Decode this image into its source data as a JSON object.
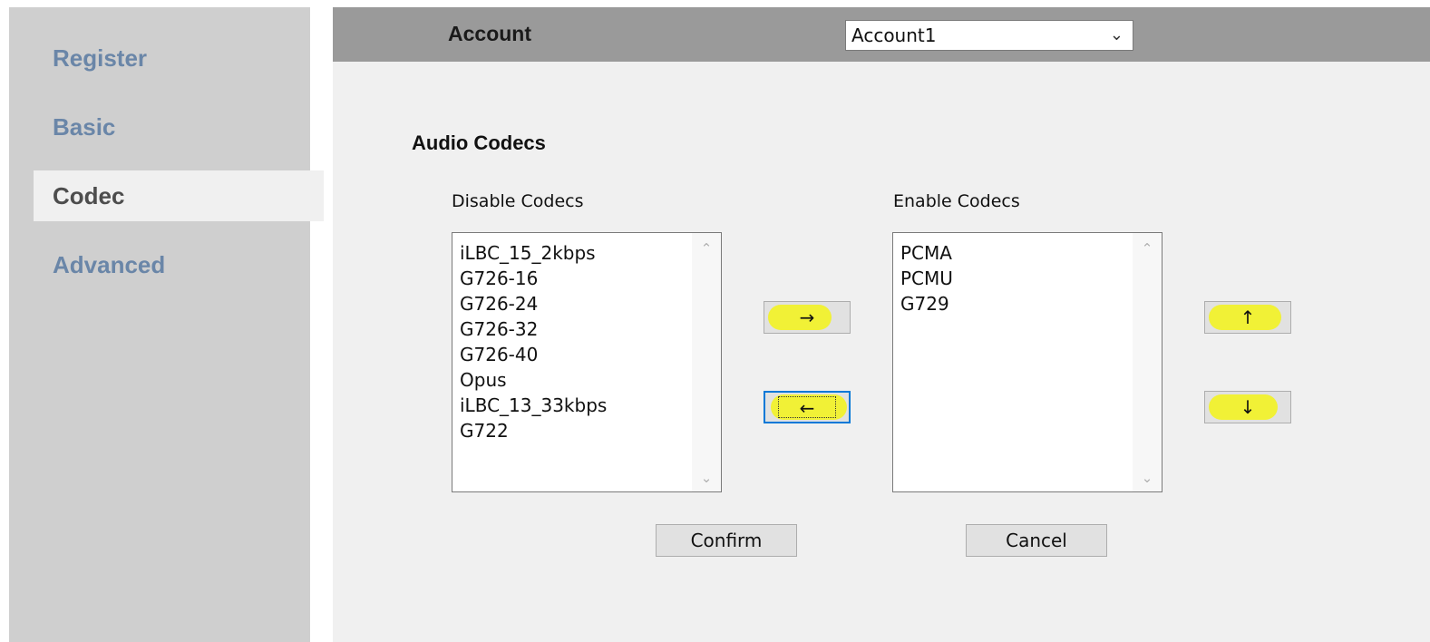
{
  "sidebar": {
    "items": [
      {
        "label": "Register",
        "active": false
      },
      {
        "label": "Basic",
        "active": false
      },
      {
        "label": "Codec",
        "active": true
      },
      {
        "label": "Advanced",
        "active": false
      }
    ]
  },
  "header": {
    "account_label": "Account",
    "account_select": {
      "value": "Account1"
    }
  },
  "codecs": {
    "section_title": "Audio Codecs",
    "disable_label": "Disable Codecs",
    "enable_label": "Enable Codecs",
    "disabled": [
      "iLBC_15_2kbps",
      "G726-16",
      "G726-24",
      "G726-32",
      "G726-40",
      "Opus",
      "iLBC_13_33kbps",
      "G722"
    ],
    "enabled": [
      "PCMA",
      "PCMU",
      "G729"
    ],
    "move_right": "→",
    "move_left": "←",
    "move_up": "↑",
    "move_down": "↓"
  },
  "footer": {
    "confirm": "Confirm",
    "cancel": "Cancel"
  },
  "colors": {
    "highlight": "#f3f318",
    "focus_border": "#0078d7",
    "sidebar_bg": "#cfcfcf",
    "sidebar_link": "#6a86a8",
    "header_bar": "#9a9a9a"
  },
  "icons": {
    "select_chevron": "chevron-down-icon",
    "scroll_up": "scroll-up-icon",
    "scroll_down": "scroll-down-icon"
  }
}
